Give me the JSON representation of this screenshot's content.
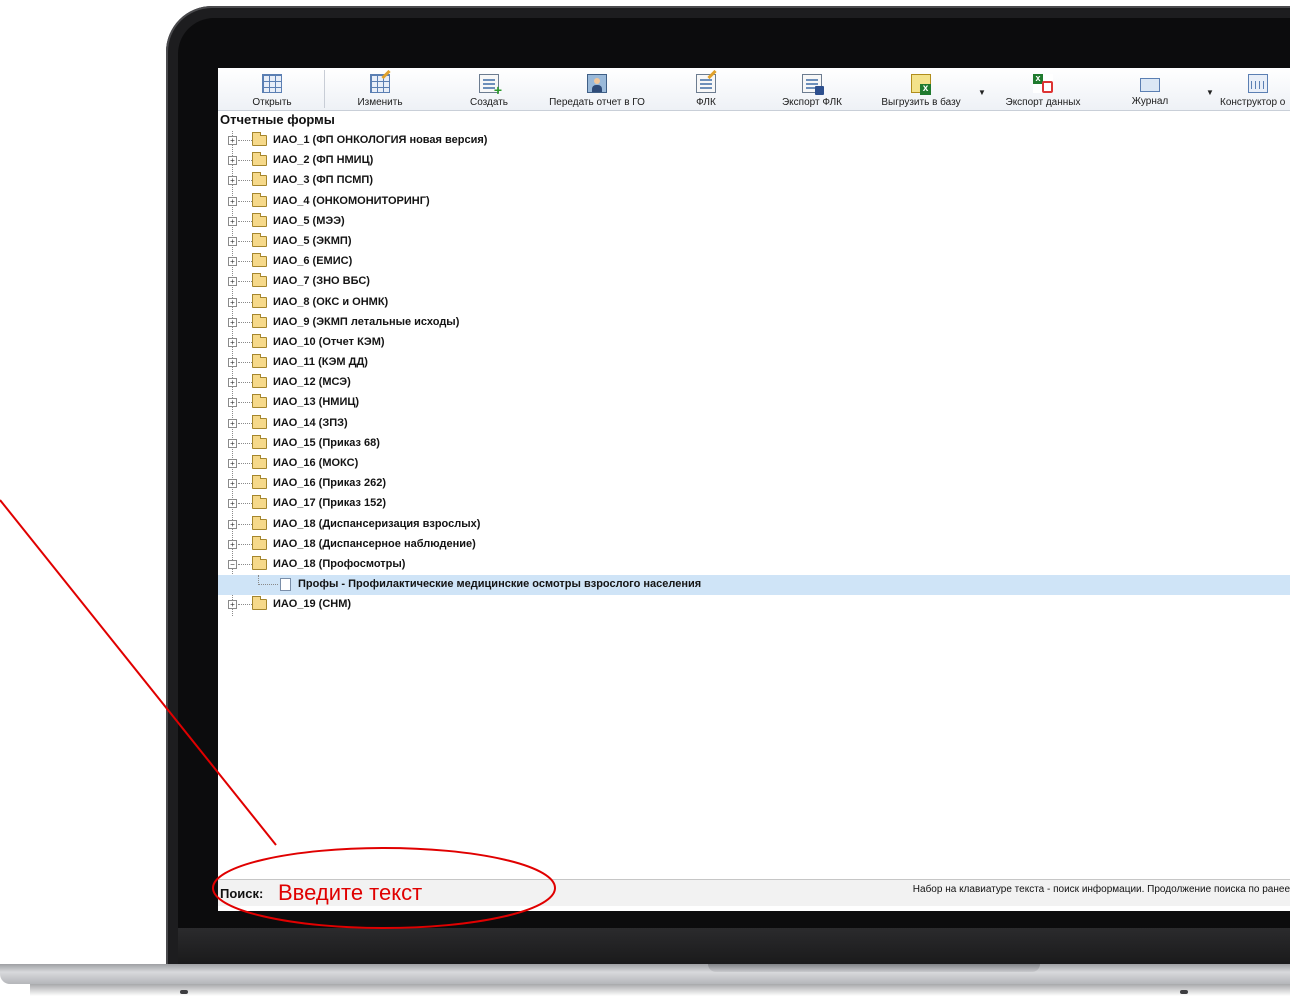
{
  "toolbar": {
    "buttons": [
      {
        "label": "Открыть",
        "icon": "grid-icon"
      },
      {
        "label": "Изменить",
        "icon": "edit-icon"
      },
      {
        "label": "Создать",
        "icon": "create-icon"
      },
      {
        "label": "Передать отчет в ГО",
        "icon": "transfer-icon"
      },
      {
        "label": "ФЛК",
        "icon": "flk-icon"
      },
      {
        "label": "Экспорт ФЛК",
        "icon": "export-flk-icon"
      },
      {
        "label": "Выгрузить в базу",
        "icon": "excel-upload-icon"
      },
      {
        "label": "Экспорт данных",
        "icon": "export-data-icon"
      },
      {
        "label": "Журнал",
        "icon": "journal-icon"
      },
      {
        "label": "Конструктор о",
        "icon": "constructor-icon"
      }
    ]
  },
  "section_title": "Отчетные формы",
  "tree": {
    "items": [
      "ИАО_1 (ФП ОНКОЛОГИЯ новая версия)",
      "ИАО_2 (ФП НМИЦ)",
      "ИАО_3 (ФП ПСМП)",
      "ИАО_4 (ОНКОМОНИТОРИНГ)",
      "ИАО_5 (МЭЭ)",
      "ИАО_5 (ЭКМП)",
      "ИАО_6 (ЕМИС)",
      "ИАО_7 (ЗНО ВБС)",
      "ИАО_8 (ОКС и ОНМК)",
      "ИАО_9 (ЭКМП летальные исходы)",
      "ИАО_10 (Отчет КЭМ)",
      "ИАО_11 (КЭМ ДД)",
      "ИАО_12 (МСЭ)",
      "ИАО_13 (НМИЦ)",
      "ИАО_14 (ЗПЗ)",
      "ИАО_15 (Приказ 68)",
      "ИАО_16 (МОКС)",
      "ИАО_16 (Приказ 262)",
      "ИАО_17 (Приказ 152)",
      "ИАО_18 (Диспансеризация взрослых)",
      "ИАО_18 (Диспансерное наблюдение)",
      "ИАО_18 (Профосмотры)"
    ],
    "expanded_child": "Профы - Профилактические медицинские осмотры взрослого населения",
    "last_item": "ИАО_19 (СНМ)",
    "expand_symbol": "+",
    "collapse_symbol": "−"
  },
  "status": {
    "search_label": "Поиск:",
    "search_placeholder": "Введите текст",
    "hint": "Набор на клавиатуре текста - поиск информации. Продолжение поиска по ранее"
  },
  "annotation_color": "#e00000"
}
